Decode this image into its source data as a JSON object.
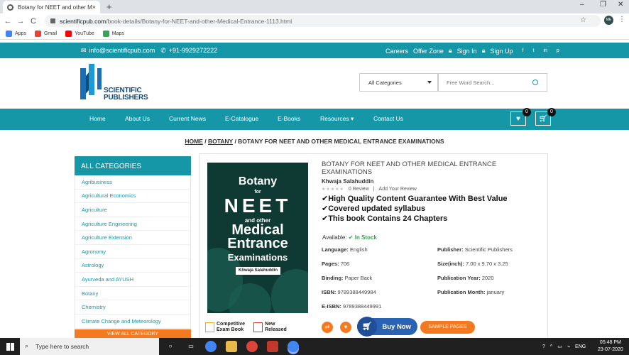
{
  "browser": {
    "tab_title": "Botany for NEET and other Medical",
    "tab_close": "×",
    "new_tab": "+",
    "back": "←",
    "forward": "→",
    "reload": "C",
    "url_host": "scientificpub.com",
    "url_path": "/book-details/Botany-for-NEET-and-other-Medical-Entrance-1113.html",
    "star": "☆",
    "profile": "ME",
    "menu": "⋮",
    "window_min": "–",
    "window_max": "❐",
    "window_close": "✕",
    "bookmarks": [
      {
        "label": "Apps",
        "color": "#4285f4"
      },
      {
        "label": "Gmail",
        "color": "#ea4335"
      },
      {
        "label": "YouTube",
        "color": "#ff0000"
      },
      {
        "label": "Maps",
        "color": "#34a853"
      }
    ]
  },
  "topbar": {
    "email": "info@scientificpub.com",
    "phone": "+91-9929272222",
    "links": [
      "Careers",
      "Offer Zone",
      "Sign In",
      "Sign Up"
    ],
    "social": [
      "f",
      "t",
      "in",
      "p"
    ]
  },
  "header": {
    "logo_line1": "SCIENTIFIC",
    "logo_line2": "PUBLISHERS",
    "category_select": "All Categories",
    "search_placeholder": "Free Word Search..."
  },
  "nav": {
    "items": [
      "Home",
      "About Us",
      "Current News",
      "E-Catalogue",
      "E-Books",
      "Resources",
      "Contact Us"
    ],
    "resources_caret": "▾",
    "wishlist_count": "0",
    "cart_count": "0"
  },
  "breadcrumb": {
    "home": "HOME",
    "sep": " / ",
    "category": "BOTANY",
    "current": "BOTANY FOR NEET AND OTHER MEDICAL ENTRANCE EXAMINATIONS"
  },
  "categories": {
    "heading": "ALL CATEGORIES",
    "items": [
      "Agribusiness",
      "Agricultural Economics",
      "Agriculture",
      "Agriculture Engineering",
      "Agriculture Extension",
      "Agronomy",
      "Astrology",
      "Ayurveda and AYUSH",
      "Botany",
      "Chemistry",
      "Climate Change and Meteorology"
    ],
    "view_all": "VIEW ALL CATEGORY"
  },
  "book": {
    "title": "BOTANY FOR NEET AND OTHER MEDICAL ENTRANCE EXAMINATIONS",
    "author": "Khwaja Salahuddin",
    "stars": "★★★★★",
    "reviews": "0 Review",
    "rating_sep": "|",
    "add_review": "Add Your Review",
    "features": [
      "✔High Quality Content Guarantee With Best Value",
      "✔Covered updated syllabus",
      "✔This book Contains 24 Chapters"
    ],
    "availability_label": "Available:",
    "availability_value": "In Stock",
    "specs": {
      "language_label": "Language:",
      "language": "English",
      "publisher_label": "Publisher:",
      "publisher": "Scientific Publishers",
      "pages_label": "Pages:",
      "pages": "706",
      "size_label": "Size(inch):",
      "size": "7.00 x 9.70 x 3.25",
      "binding_label": "Binding:",
      "binding": "Paper Back",
      "pubyear_label": "Publication Year:",
      "pubyear": "2020",
      "isbn_label": "ISBN:",
      "isbn": "9789388449984",
      "pubmonth_label": "Publication Month:",
      "pubmonth": "january",
      "eisbn_label": "E-ISBN:",
      "eisbn": "9789388449991"
    },
    "buy_now": "Buy Now",
    "sample_pages": "SAMPLE PAGES",
    "badge1": [
      "Competitive",
      "Exam Book"
    ],
    "badge2": [
      "New",
      "Released"
    ]
  },
  "cover": {
    "line1": "Botany",
    "line2": "for",
    "line3": "NEET",
    "line4": "and other",
    "line5a": "Medical",
    "line5b": "Entrance",
    "line5c": "Examinations",
    "author": "Khwaja Salahuddin"
  },
  "taskbar": {
    "search_placeholder": "Type here to search",
    "lang": "ENG",
    "time": "05:48 PM",
    "date": "23-07-2020"
  },
  "colors": {
    "teal": "#1597a8",
    "orange": "#f47a22",
    "blue": "#2a63b4",
    "green": "#2eaa4a"
  }
}
